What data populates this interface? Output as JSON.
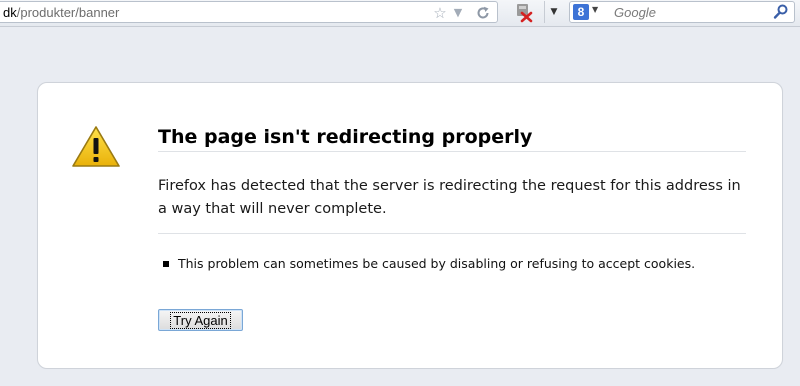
{
  "toolbar": {
    "url_domain": "dk",
    "url_path": "/produkter/banner",
    "bookmark_icon": "star-icon",
    "dropdown_icon": "triangle-down-icon",
    "reload_icon": "reload-icon",
    "addon_icon": "addon-block-icon",
    "search_engine_letter": "8",
    "search_placeholder": "Google"
  },
  "error": {
    "title": "The page isn't redirecting properly",
    "description": "Firefox has detected that the server is redirecting the request for this address in a way that will never complete.",
    "details": [
      "This problem can sometimes be caused by disabling or refusing to accept cookies."
    ],
    "try_again_label": "Try Again"
  },
  "colors": {
    "page_background": "#e9ecf2",
    "warning_yellow": "#f5c518",
    "button_focus_border": "#7aa7d6"
  }
}
